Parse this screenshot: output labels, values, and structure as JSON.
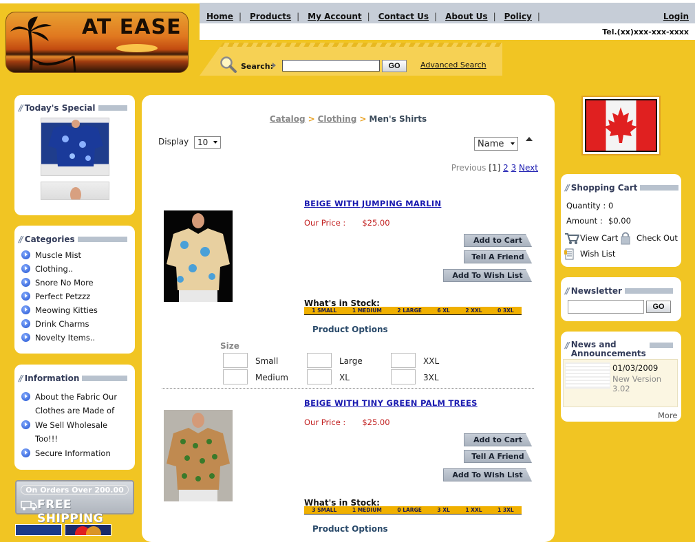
{
  "header": {
    "logo_text": "AT EASE",
    "nav": [
      "Home",
      "Products",
      "My Account",
      "Contact Us",
      "About Us",
      "Policy"
    ],
    "login": "Login",
    "tel": "Tel.(xx)xxx-xxx-xxxx",
    "search_label": "Search:",
    "search_value": "",
    "go_label": "GO",
    "advanced_search": "Advanced Search"
  },
  "left": {
    "todays_special_title": "Today's Special",
    "categories_title": "Categories",
    "categories": [
      "Muscle Mist",
      "Clothing..",
      "Snore No More",
      "Perfect Petzzz",
      "Meowing Kitties",
      "Drink Charms",
      "Novelty Items.."
    ],
    "information_title": "Information",
    "information": [
      "About the Fabric Our Clothes are Made of",
      "We Sell Wholesale Too!!!",
      "Secure Information"
    ],
    "free_shipping_top": "On Orders Over 200.00",
    "free_shipping_main": "FREE SHIPPING"
  },
  "main": {
    "breadcrumb": {
      "catalog": "Catalog",
      "clothing": "Clothing",
      "current": "Men's Shirts",
      "sep": ">"
    },
    "display_label": "Display",
    "display_value": "10",
    "sort_value": "Name",
    "pager": {
      "previous": "Previous",
      "current": "[1]",
      "p2": "2",
      "p3": "3",
      "next": "Next"
    },
    "products": [
      {
        "name": "BEIGE WITH JUMPING MARLIN",
        "price_label": "Our Price :",
        "price": "$25.00",
        "buttons": [
          "Add to Cart",
          "Tell A Friend",
          "Add To Wish List"
        ],
        "stock_title": "What's in Stock:",
        "stock": [
          "1 SMALL",
          "1 MEDIUM",
          "2 LARGE",
          "6 XL",
          "2 XXL",
          "0 3XL"
        ],
        "options_title": "Product Options"
      },
      {
        "name": "BEIGE WITH TINY GREEN PALM TREES",
        "price_label": "Our Price :",
        "price": "$25.00",
        "buttons": [
          "Add to Cart",
          "Tell A Friend",
          "Add To Wish List"
        ],
        "stock_title": "What's in Stock:",
        "stock": [
          "3 SMALL",
          "1 MEDIUM",
          "0 LARGE",
          "3 XL",
          "1 XXL",
          "1 3XL"
        ],
        "options_title": "Product Options"
      }
    ],
    "size_label": "Size",
    "sizes": [
      "Small",
      "Large",
      "XXL",
      "Medium",
      "XL",
      "3XL"
    ]
  },
  "right": {
    "cart_title": "Shopping Cart",
    "quantity_label": "Quantity :",
    "quantity": "0",
    "amount_label": "Amount :",
    "amount": "$0.00",
    "view_cart": "View Cart",
    "check_out": "Check Out",
    "wish_list": "Wish List",
    "newsletter_title": "Newsletter",
    "newsletter_value": "",
    "news_title": "News and Announcements",
    "news_date": "01/03/2009",
    "news_text": "New Version 3.02",
    "more": "More"
  }
}
